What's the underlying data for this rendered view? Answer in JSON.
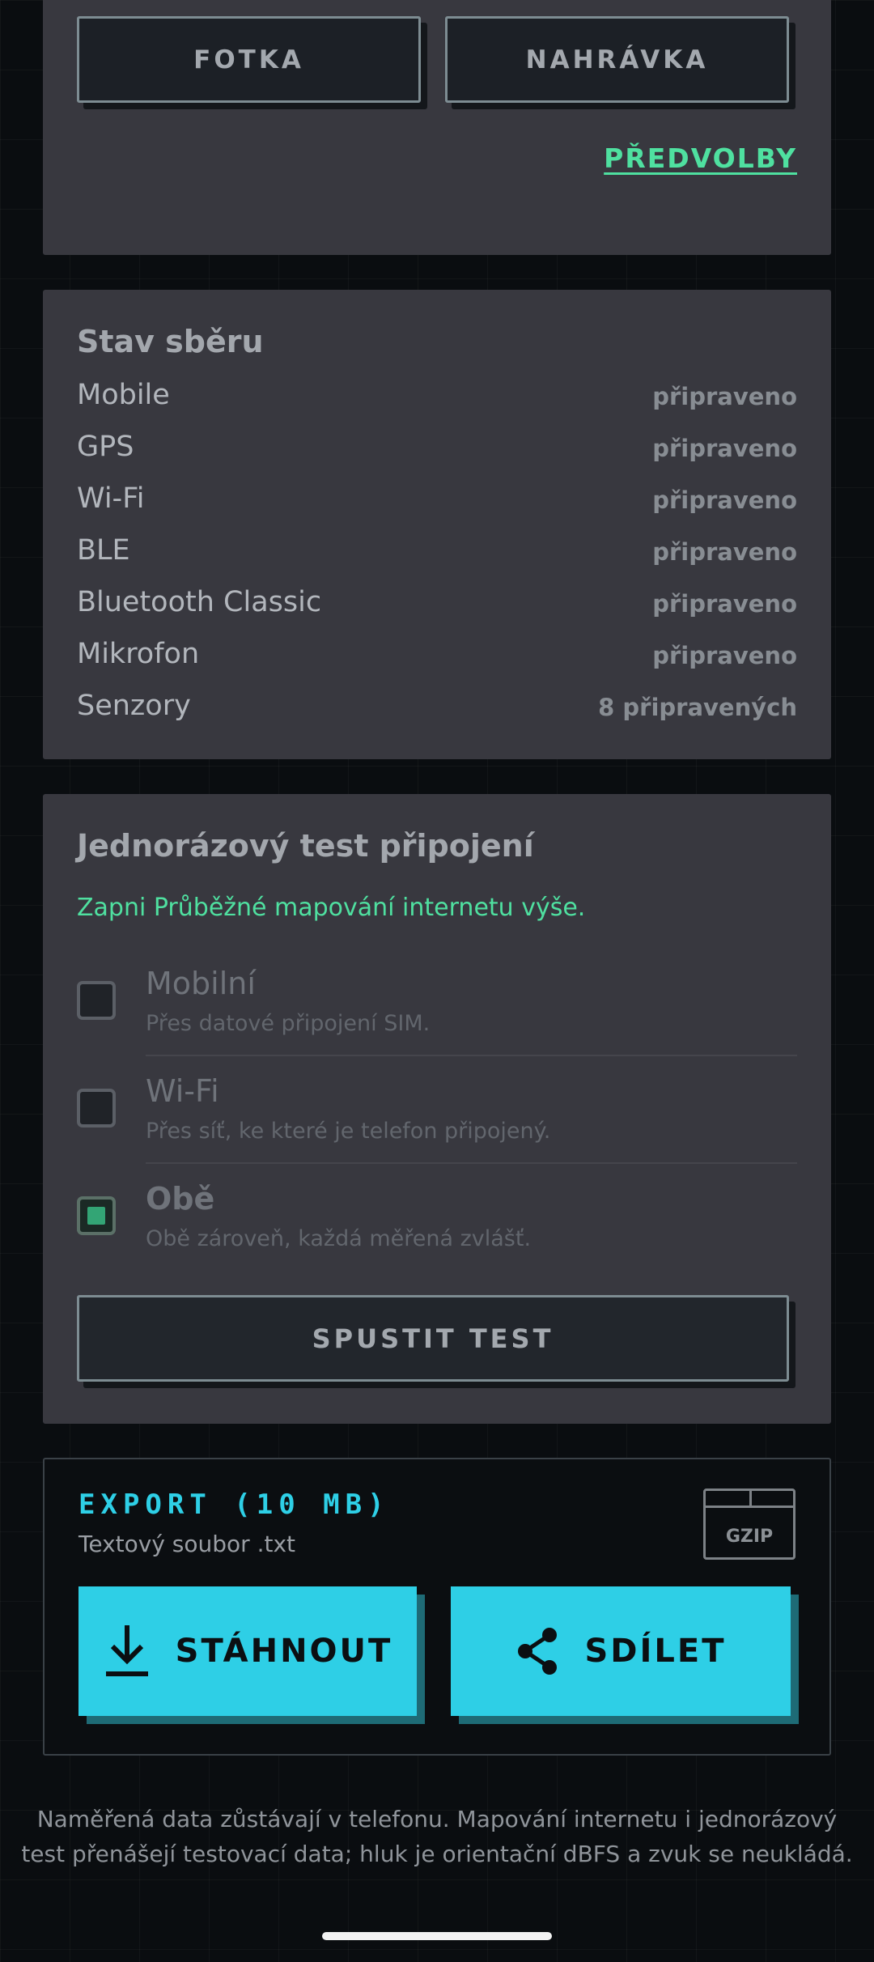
{
  "media": {
    "photo_label": "FOTKA",
    "recording_label": "NAHRÁVKA",
    "presets_label": "PŘEDVOLBY"
  },
  "status": {
    "title": "Stav sběru",
    "rows": [
      {
        "label": "Mobile",
        "value": "připraveno"
      },
      {
        "label": "GPS",
        "value": "připraveno"
      },
      {
        "label": "Wi-Fi",
        "value": "připraveno"
      },
      {
        "label": "BLE",
        "value": "připraveno"
      },
      {
        "label": "Bluetooth Classic",
        "value": "připraveno"
      },
      {
        "label": "Mikrofon",
        "value": "připraveno"
      },
      {
        "label": "Senzory",
        "value": "8 připravených"
      }
    ]
  },
  "test": {
    "title": "Jednorázový test připojení",
    "hint": "Zapni Průběžné mapování internetu výše.",
    "options": [
      {
        "title": "Mobilní",
        "subtitle": "Přes datové připojení SIM.",
        "checked": false
      },
      {
        "title": "Wi-Fi",
        "subtitle": "Přes síť, ke které je telefon připojený.",
        "checked": false
      },
      {
        "title": "Obě",
        "subtitle": "Obě zároveň, každá měřená zvlášť.",
        "checked": true
      }
    ],
    "run_label": "SPUSTIT TEST"
  },
  "export": {
    "title": "EXPORT (10 MB)",
    "subtitle": "Textový soubor .txt",
    "gzip_label": "GZIP",
    "download_label": "STÁHNOUT",
    "share_label": "SDÍLET",
    "accent_color": "#2ecfe6"
  },
  "footer": {
    "line1": "Naměřená data zůstávají v telefonu. Mapování internetu i jednorázový",
    "line2": "test přenášejí testovací data; hluk je orientační dBFS a zvuk se neukládá."
  },
  "colors": {
    "card": "#38383f",
    "accent_green": "#4fe0a0",
    "accent_cyan": "#2ecfe6"
  }
}
